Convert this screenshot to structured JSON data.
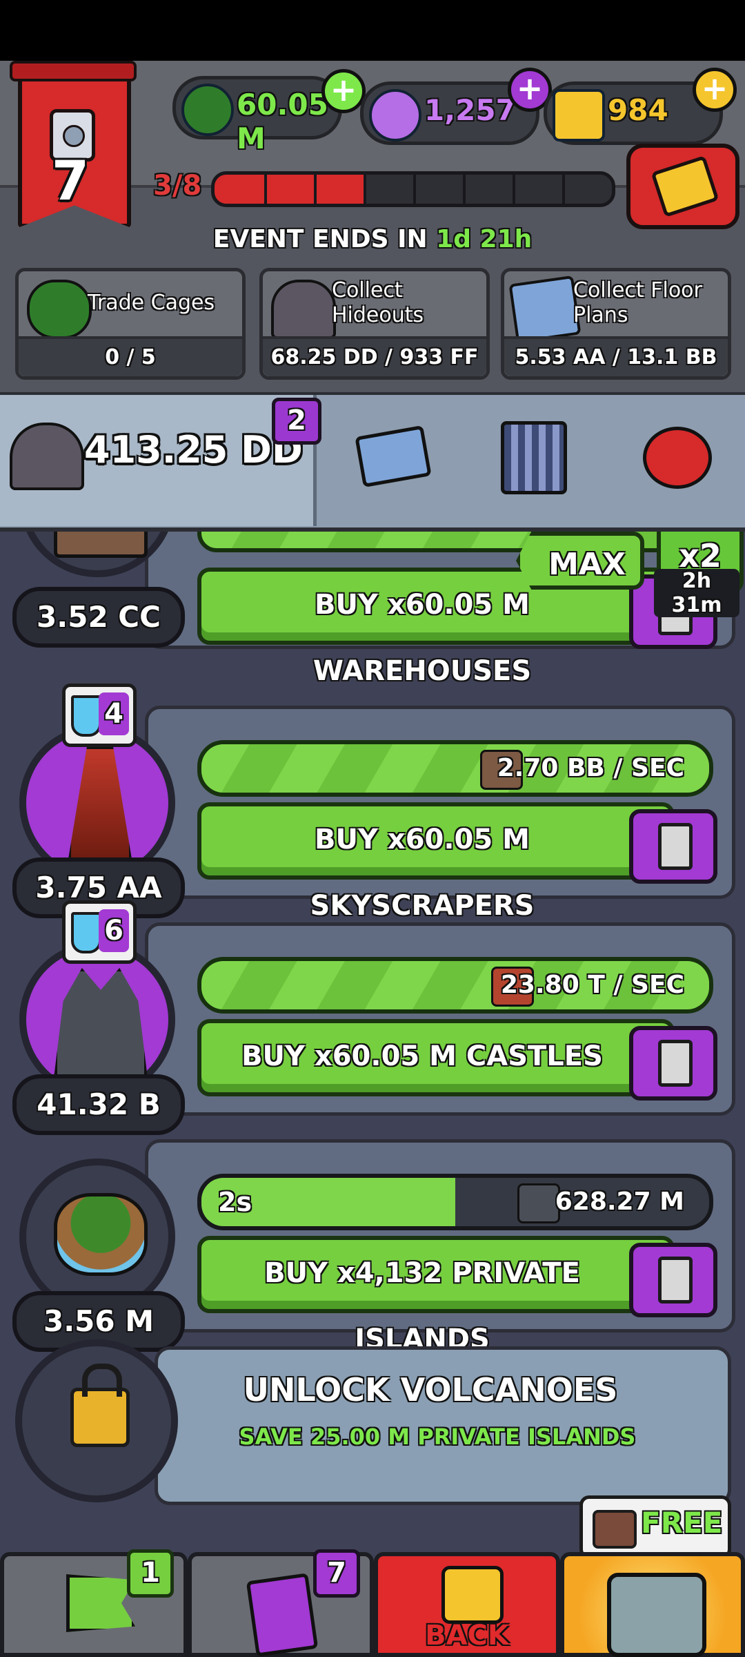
{
  "colors": {
    "accent_green": "#76cf3f",
    "accent_purple": "#a23ad3",
    "accent_red": "#d62a2b",
    "gold": "#f5c52d",
    "highlight_green": "#7ee84b"
  },
  "header": {
    "level": "7",
    "level_icon": "robot-badge-icon",
    "currencies": [
      {
        "name": "cash",
        "value": "60.05 M",
        "icon": "green-cash-icon",
        "color": "#7ee84b"
      },
      {
        "name": "elixir",
        "value": "1,257",
        "icon": "purple-potion-icon",
        "color": "#c87af0"
      },
      {
        "name": "gold",
        "value": "984",
        "icon": "gold-bars-icon",
        "color": "#f5c52d"
      }
    ],
    "progress": {
      "text": "3/8",
      "current": 3,
      "total": 8
    },
    "reward_icon": "gold-bars-laurel-icon"
  },
  "event": {
    "prefix": "EVENT ENDS IN",
    "days": "1d",
    "hours": "21h",
    "tasks": [
      {
        "name": "Trade Cages",
        "progress": "0 / 5",
        "icon": "cage-monster-icon"
      },
      {
        "name": "Collect Hideouts",
        "progress": "68.25 DD / 933 FF",
        "icon": "hideout-icon"
      },
      {
        "name": "Collect Floor Plans",
        "progress": "5.53 AA / 13.1 BB",
        "icon": "floor-plan-icon"
      }
    ]
  },
  "tabs": {
    "main_amount": "413.25 DD",
    "badge": "2",
    "icons": [
      "floor-plan-icon",
      "cage-icon",
      "red-alarm-button-icon"
    ]
  },
  "rows": [
    {
      "cost": "3.52 CC",
      "buy_label": "BUY x60.05 M WAREHOUSES",
      "max_label": "MAX",
      "boost_label": "x2",
      "boost_timer": "2h 31m",
      "building_icon": "warehouse-icon"
    },
    {
      "cost": "3.75 AA",
      "science": "4",
      "rate": "2.70 BB / SEC",
      "buy_label": "BUY x60.05 M SKYSCRAPERS",
      "building_icon": "skyscraper-icon",
      "fill": 1.0
    },
    {
      "cost": "41.32 B",
      "science": "6",
      "rate": "23.80 T / SEC",
      "buy_label": "BUY x60.05 M CASTLES",
      "building_icon": "castle-icon",
      "fill": 1.0
    },
    {
      "cost": "3.56 M",
      "timer": "2s",
      "rate": "628.27 M",
      "buy_label": "BUY x4,132 PRIVATE ISLANDS",
      "building_icon": "private-island-icon",
      "fill": 0.5
    }
  ],
  "unlock": {
    "title": "UNLOCK VOLCANOES",
    "subtitle": "SAVE 25.00 M PRIVATE ISLANDS",
    "icon": "padlock-icon"
  },
  "nav": {
    "flag_count": "1",
    "cards_count": "7",
    "back_label": "BACK",
    "free_label": "FREE"
  }
}
